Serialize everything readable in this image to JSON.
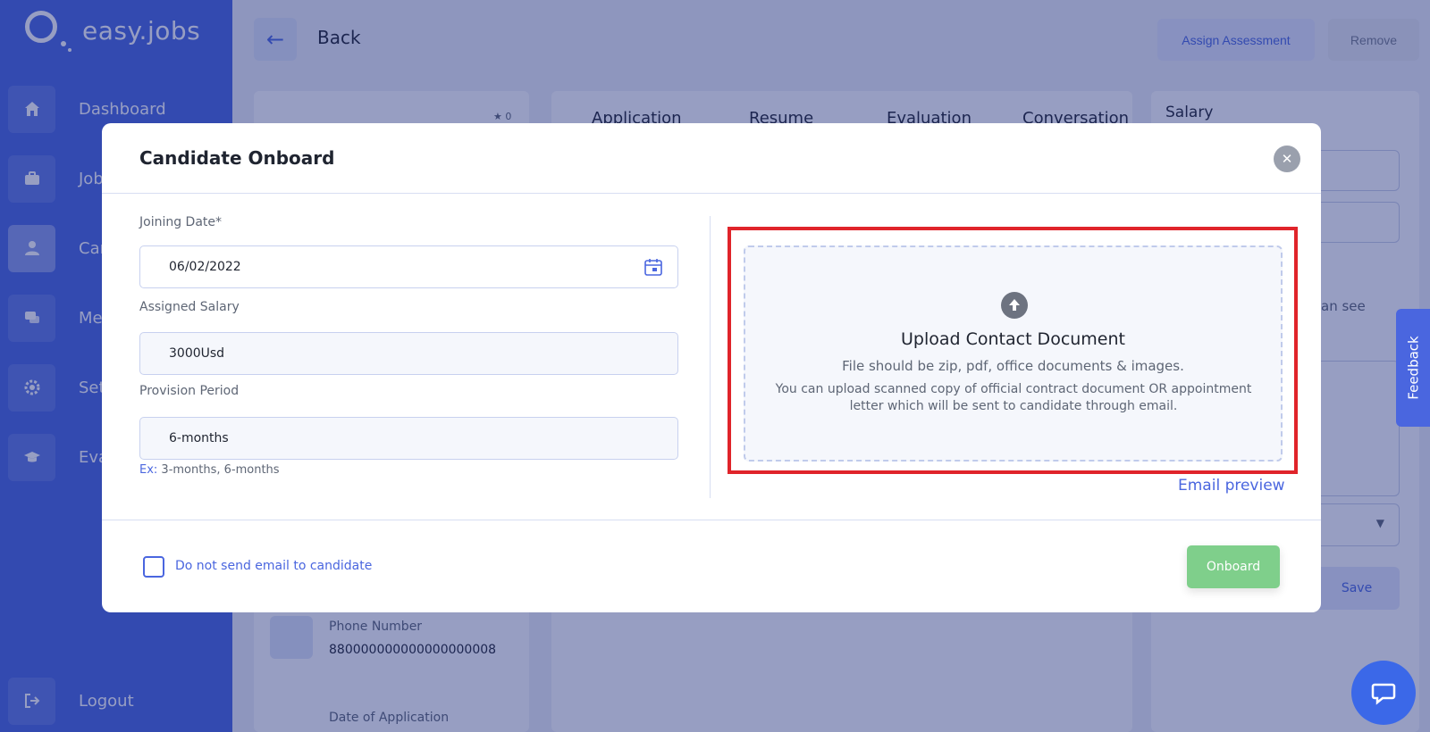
{
  "app": {
    "logo_text": "easy.jobs"
  },
  "sidebar": {
    "items": [
      {
        "label": "Dashboard",
        "icon": "home-icon"
      },
      {
        "label": "Jobs",
        "icon": "briefcase-icon"
      },
      {
        "label": "Candidates",
        "icon": "user-icon"
      },
      {
        "label": "Messages",
        "icon": "chat-icon"
      },
      {
        "label": "Settings",
        "icon": "gear-icon"
      },
      {
        "label": "Evaluation",
        "icon": "graduation-cap-icon"
      }
    ],
    "logout": "Logout"
  },
  "topbar": {
    "back_label": "Back",
    "assign_label": "Assign Assessment",
    "remove_label": "Remove"
  },
  "tabs": [
    "Application",
    "Resume",
    "Evaluation",
    "Conversation"
  ],
  "right_panel": {
    "title": "Salary",
    "partial_text": "an see",
    "save_label": "Save"
  },
  "profile": {
    "rating": "0",
    "phone_label": "Phone Number",
    "phone_value": "880000000000000000008",
    "date_label": "Date of Application"
  },
  "feedback_label": "Feedback",
  "modal": {
    "title": "Candidate Onboard",
    "joining_date": {
      "label": "Joining Date*",
      "value": "06/02/2022"
    },
    "assigned_salary": {
      "label": "Assigned Salary",
      "value": "3000Usd"
    },
    "provision_period": {
      "label": "Provision Period",
      "value": "6-months",
      "hint_prefix": "Ex:",
      "hint_text": " 3-months, 6-months"
    },
    "upload": {
      "title": "Upload Contact Document",
      "subtitle": "File should be zip, pdf, office documents & images.",
      "description": "You can upload scanned copy of official contract document OR appointment letter which will be sent to candidate through email."
    },
    "email_preview": "Email preview",
    "checkbox_label": "Do not send email to candidate",
    "onboard_label": "Onboard"
  },
  "colors": {
    "primary": "#4a66df",
    "success": "#7fcf8b",
    "highlight": "#e0242a"
  }
}
